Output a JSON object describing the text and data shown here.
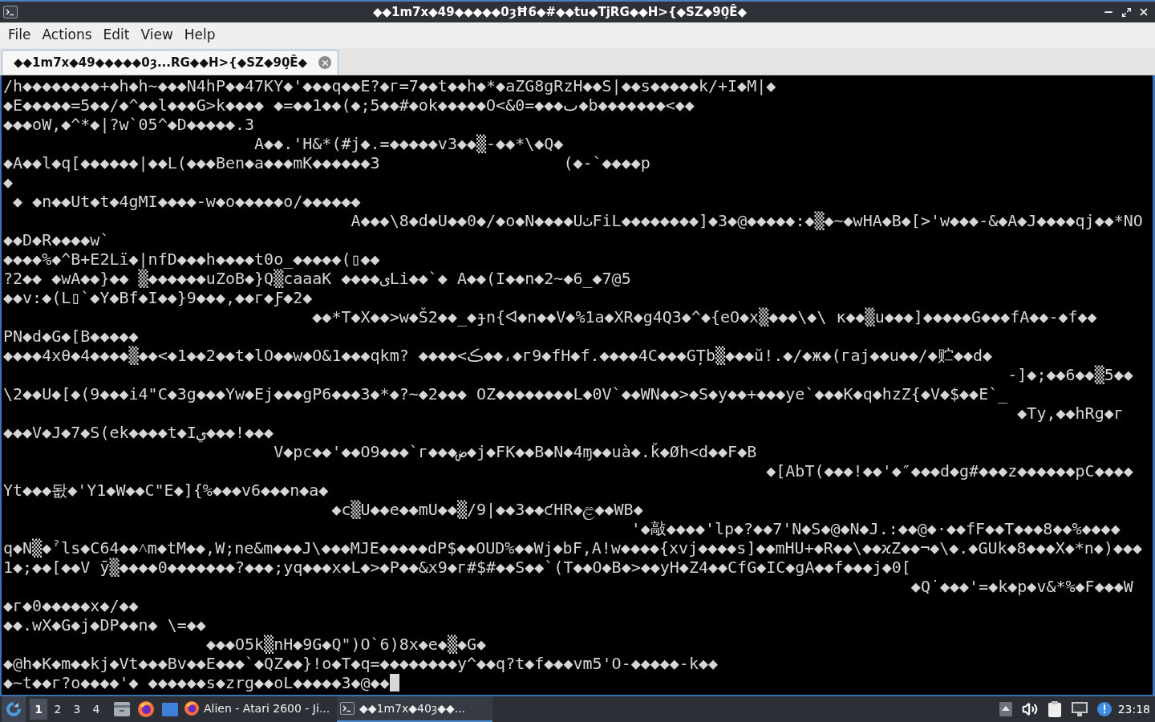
{
  "window": {
    "title": "◆◆1m7x◆49◆◆◆◆◆0ȝĦ6◆#◆◆tu◆TjRG◆◆H>{◆SZ◆90̧Ê◆"
  },
  "menu": [
    "File",
    "Actions",
    "Edit",
    "View",
    "Help"
  ],
  "tabs": [
    {
      "label": "◆◆1m7x◆49◆◆◆◆◆0ȝ...RG◆◆H>{◆SZ◆90̧Ê◆",
      "selected": true
    }
  ],
  "terminal": {
    "lines": [
      "/h◆◆◆◆◆◆◆◆+◆h◆h~◆◆◆N4hP◆◆47KY◆'◆◆◆q◆◆E?◆г=7◆◆t◆◆h◆*◆aZG8gRzH◆◆S|◆◆s◆◆◆◆◆k/+I◆M|◆",
      "◆E◆◆◆◆◆=5◆◆/◆^◆◆l◆◆◆G>k◆◆◆◆ ◆=◆◆1◆◆(◆;5◆◆#◆ok◆◆◆◆◆O<&0=◆◆◆ٮ◆b◆◆◆◆◆◆◆<◆◆",
      "◆◆◆oW,◆^*◆|?w`05^◆D◆◆◆◆◆.3",
      "                          A◆◆.'H&*(#j◆.=◆◆◆◆◆v3◆◆▒-◆◆*\\◆Q◆",
      "◆A◆◆l◆q[◆◆◆◆◆◆|◆◆L(◆◆◆Ben◆a◆◆◆mK◆◆◆◆◆◆3                   (◆-`◆◆◆◆p",
      "◆",
      " ◆ ◆n◆◆Ut◆t◆4gMI◆◆◆◆-w◆o◆◆◆◆◆o/◆◆◆◆◆◆",
      "                                    A◆◆◆\\8◆d◆U◆◆0◆/◆o◆N◆◆◆◆UٺFiL◆◆◆◆◆◆◆◆]◆3◆@◆◆◆◆◆:◆▒◆~◆wHA◆B◆[>'w◆◆◆-&◆A◆J◆◆◆◆qj◆◆*NO",
      "◆◆D◆R◆◆◆◆w`",
      "◆◆◆◆%◆^B+E2Lï◆|nfD◆◆◆h◆◆◆◆t0o_◆◆◆◆◆(▯◆◆",
      "?2◆◆ ◆wA◆◆}◆◆ ▒◆◆◆◆◆◆uZoB◆}Q▒caaaK ◆◆◆◆یLi◆◆`◆ A◆◆(I◆◆n◆2~◆6_◆7@5",
      "◆◆v:◆(L▯`◆Y◆Bf◆I◆◆}9◆◆◆,◆◆г◆Ƒ◆2◆",
      "                                ◆◆*T◆X◆◆>w◆Š2◆◆_◆ɟn{ᐊ◆n◆◆V◆%1a◆XR◆g4Q3◆^◆{eO◆x▒◆◆◆\\◆\\ к◆◆▒u◆◆◆]◆◆◆◆◆G◆◆◆fA◆◆-◆f◆◆",
      "PN◆d◆G◆[B◆◆◆◆◆",
      "◆◆◆◆4xθ◆4◆◆◆◆▒◆◆<◆1◆◆2◆◆t◆lO◆◆w◆O&1◆◆◆qkm? ◆◆◆◆<ڪ◆◆،◆г9◆fH◆f.◆◆◆◆4C◆◆◆GȚb▒◆◆◆ŭ!.◆/◆ж◆(гaj◆◆u◆◆/◆贮◆◆d◆",
      "                                                                                                        -]◆;◆◆6◆◆▒5◆◆",
      "\\2◆◆U◆[◆(9◆◆◆i4\"C◆3g◆◆◆Yw◆Ej◆◆◆gP6◆◆◆3◆*◆?~◆2◆◆◆ OZ◆◆◆◆◆◆◆◆L◆0V`◆◆WN◆◆>◆S◆y◆◆+◆◆◆ye`◆◆◆K◆q◆hzZ{◆V◆$◆◆E`_",
      "                                                                                                         ◆Ty,◆◆hRg◆г",
      "◆◆◆V◆J◆7◆S(ek◆◆◆◆t◆Iي◆◆◆!◆◆◆",
      "                            V◆pc◆◆'◆◆O9◆◆◆`г◆◆◆ض◆j◆FK◆◆B◆N◆4ɱ◆◆uà◆.ǩ◆Øh<d◆◆F◆B",
      "                                                                               ◆[AbT(◆◆◆!◆◆'◆″◆◆◆d◆g#◆◆◆z◆◆◆◆◆◆pC◆◆◆◆",
      "Yt◆◆◆돲◆'Y1◆W◆◆C\"E◆]{%◆◆◆v6◆◆◆n◆a◆",
      "                                  ◆c▒U◆◆e◆◆mU◆◆▒/9|◆◆3◆◆ƈHR◆ළ◆◆WB◆",
      "                                                                 '◆敲◆◆◆◆'lp◆?◆◆7'N◆S◆@◆N◆J.:◆◆@◆·◆◆fF◆◆T◆◆◆8◆◆%◆◆◆◆",
      "q◆N▒◆ˀls◆C64◆◆˄m◆tM◆◆,W;ne&m◆◆◆J\\◆◆◆MJE◆◆◆◆◆dP$◆◆OUD%◆◆Wj◆bF,A!w◆◆◆◆{xvj◆◆◆◆s]◆◆mHU+◆R◆◆\\◆◆ϰZ◆◆¬◆\\◆.◆GUk◆8◆◆◆X◆*n◆)◆◆◆",
      "1◆;◆◆[◆◆V ȳ▒◆◆◆◆0◆◆◆◆◆◆◆?◆◆◆;yq◆◆◆x◆L◆>◆P◆◆&x9◆г#$#◆◆S◆◆`(T◆◆O◆B◆>◆◆yH◆Z4◆◆CfG◆IC◆gA◆◆f◆◆◆j◆0[",
      "                                                                                              ◆Q˙◆◆◆'=◆k◆p◆v&*%◆F◆◆◆W",
      "◆г◆0◆◆◆◆◆x◆/◆◆",
      "◆◆.wX◆G◆j◆DP◆◆n◆ \\=◆◆",
      "                     ◆◆◆O5k▒nH◆9G◆Q\")O`6)8x◆e◆▒◆G◆",
      "◆@h◆K◆m◆◆kj◆Vt◆◆◆Bv◆◆E◆◆◆`◆QZ◆◆}!o◆T◆q=◆◆◆◆◆◆◆◆y^◆◆q?t◆f◆◆◆vm5'O-◆◆◆◆◆-k◆◆",
      "◆~t◆◆г?o◆◆◆◆'◆ ◆◆◆◆◆◆s◆zrg◆◆oL◆◆◆◆◆3◆@◆◆"
    ]
  },
  "taskbar": {
    "desktops": [
      {
        "label": "1",
        "selected": true
      },
      {
        "label": "2",
        "selected": false
      },
      {
        "label": "3",
        "selected": false
      },
      {
        "label": "4",
        "selected": false
      }
    ],
    "tasks": [
      {
        "kind": "browser",
        "label": "Alien - Atari 2600 - Ji...",
        "selected": false
      },
      {
        "kind": "terminal",
        "label": "◆◆1m7x◆40ȝ◆◆...",
        "selected": true
      }
    ],
    "clock": "23:18"
  }
}
